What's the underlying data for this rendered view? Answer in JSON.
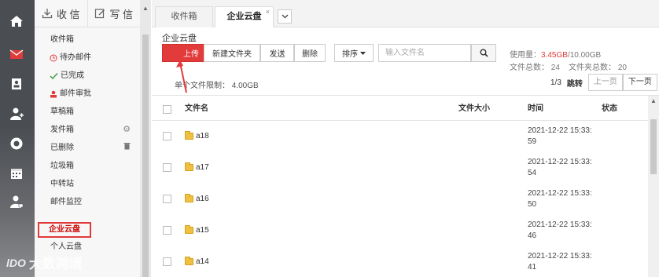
{
  "compose": {
    "receive_label": "收 信",
    "write_label": "写 信"
  },
  "folders": [
    {
      "label": "收件箱",
      "icon": ""
    },
    {
      "label": "待办邮件",
      "icon": "clock-icon"
    },
    {
      "label": "已完成",
      "icon": "check-icon"
    },
    {
      "label": "邮件审批",
      "icon": "approver-icon"
    },
    {
      "label": "草稿箱",
      "icon": ""
    },
    {
      "label": "发件箱",
      "icon": "",
      "trail": "gear-icon"
    },
    {
      "label": "已删除",
      "icon": "",
      "trail": "trash-icon"
    },
    {
      "label": "垃圾箱",
      "icon": ""
    },
    {
      "label": "中转站",
      "icon": ""
    },
    {
      "label": "邮件监控",
      "icon": ""
    }
  ],
  "folders_bottom": [
    {
      "label": "企业云盘",
      "active": true
    },
    {
      "label": "个人云盘"
    }
  ],
  "tabs": [
    {
      "label": "收件箱"
    },
    {
      "label": "企业云盘",
      "close": "×"
    }
  ],
  "breadcrumb": "企业云盘",
  "toolbar": {
    "upload": "上传",
    "new_folder": "新建文件夹",
    "send": "发送",
    "delete": "删除",
    "sort": "排序"
  },
  "search": {
    "placeholder": "输入文件名"
  },
  "limit": "单个文件限制： 4.00GB",
  "usage": {
    "label": "使用量：",
    "used": "3.45GB",
    "total": "/10.00GB"
  },
  "counts": {
    "files_label": "文件总数：",
    "files": "24",
    "folders_label": "文件夹总数：",
    "folders": "20"
  },
  "pager": {
    "page": "1/3",
    "jump": "跳转",
    "prev": "上一页",
    "next": "下一页"
  },
  "table": {
    "headers": {
      "name": "文件名",
      "size": "文件大小",
      "time": "时间",
      "status": "状态"
    },
    "rows": [
      {
        "name": "a18",
        "date": "2021-12-22 15:33:",
        "sec": "59"
      },
      {
        "name": "a17",
        "date": "2021-12-22 15:33:",
        "sec": "54"
      },
      {
        "name": "a16",
        "date": "2021-12-22 15:33:",
        "sec": "50"
      },
      {
        "name": "a15",
        "date": "2021-12-22 15:33:",
        "sec": "46"
      },
      {
        "name": "a14",
        "date": "2021-12-22 15:33:",
        "sec": "41"
      }
    ]
  },
  "watermark": {
    "logo": "lDO",
    "text": "大数跨境"
  },
  "colors": {
    "accent": "#e23b3b",
    "rail": "#4a4d52",
    "folder": "#f0c040"
  }
}
